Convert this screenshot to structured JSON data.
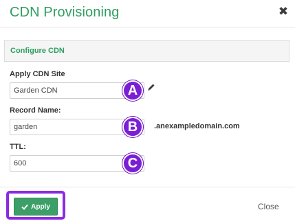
{
  "dialog": {
    "title": "CDN Provisioning",
    "close_glyph": "✖"
  },
  "panel": {
    "title": "Configure CDN"
  },
  "form": {
    "site": {
      "label": "Apply CDN Site",
      "value": "Garden CDN"
    },
    "record": {
      "label": "Record Name:",
      "value": "garden",
      "suffix": ".anexampledomain.com"
    },
    "ttl": {
      "label": "TTL:",
      "value": "600"
    }
  },
  "annotations": [
    "A",
    "B",
    "C"
  ],
  "footer": {
    "apply_label": "Apply",
    "close_label": "Close"
  },
  "icons": {
    "close": "close-icon",
    "edit": "pencil-icon",
    "apply": "check-icon"
  },
  "colors": {
    "accent_green": "#2e9e5f",
    "button_green": "#3c9f68",
    "annotation_purple": "#7a1fd6"
  }
}
